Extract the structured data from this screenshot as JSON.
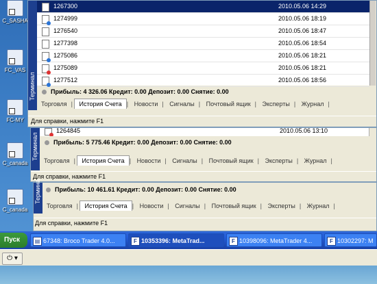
{
  "desktop_icons": [
    {
      "label": "C_SASHA"
    },
    {
      "label": "FC_VAS"
    },
    {
      "label": "FC-MY"
    },
    {
      "label": "C_canada"
    },
    {
      "label": "C_canada"
    }
  ],
  "window1": {
    "panel_label": "Терминал",
    "rows": [
      {
        "ticket": "1267300",
        "time": "2010.05.06 14:29",
        "selected": true,
        "icon": "doc"
      },
      {
        "ticket": "1274999",
        "time": "2010.05.06 18:19",
        "selected": false,
        "icon": "blue"
      },
      {
        "ticket": "1276540",
        "time": "2010.05.06 18:47",
        "selected": false,
        "icon": "doc"
      },
      {
        "ticket": "1277398",
        "time": "2010.05.06 18:54",
        "selected": false,
        "icon": "doc"
      },
      {
        "ticket": "1275086",
        "time": "2010.05.06 18:21",
        "selected": false,
        "icon": "blue"
      },
      {
        "ticket": "1275089",
        "time": "2010.05.06 18:21",
        "selected": false,
        "icon": "red"
      },
      {
        "ticket": "1277512",
        "time": "2010.05.06 18:56",
        "selected": false,
        "icon": "blue"
      }
    ],
    "status": "Прибыль: 4 326.06  Кредит: 0.00  Депозит: 0.00  Снятие: 0.00",
    "tabs": [
      "Торговля",
      "История Счета",
      "Новости",
      "Сигналы",
      "Почтовый ящик",
      "Эксперты",
      "Журнал"
    ],
    "active_tab": "История Счета",
    "help": "Для справки, нажмите F1"
  },
  "window2": {
    "panel_label": "Терминал",
    "rows": [
      {
        "ticket": "1264845",
        "time": "2010.05.06 13:10",
        "icon": "red"
      }
    ],
    "status": "Прибыль: 5 775.46  Кредит: 0.00  Депозит: 0.00  Снятие: 0.00",
    "tabs": [
      "Торговля",
      "История Счета",
      "Новости",
      "Сигналы",
      "Почтовый ящик",
      "Эксперты",
      "Журнал"
    ],
    "active_tab": "История Счета",
    "help": "Для справки, нажмите F1"
  },
  "window3": {
    "panel_label": "Термина",
    "status": "Прибыль: 10 461.61  Кредит: 0.00  Депозит: 0.00  Снятие: 0.00",
    "tabs": [
      "Торговля",
      "История Счета",
      "Новости",
      "Сигналы",
      "Почтовый ящик",
      "Эксперты",
      "Журнал"
    ],
    "active_tab": "История Счета",
    "help": "Для справки, нажмите F1"
  },
  "taskbar": {
    "start_label": "Пуск",
    "items": [
      {
        "label": "67348: Broco Trader 4.0...",
        "active": false,
        "icon": "chart-icon"
      },
      {
        "label": "10353396: MetaTrad...",
        "active": true,
        "icon": "F"
      },
      {
        "label": "10398096: MetaTrader 4...",
        "active": false,
        "icon": "F"
      },
      {
        "label": "10302297: M",
        "active": false,
        "icon": "F"
      }
    ]
  },
  "bottombar": {
    "power_label": "⏻ ▾"
  }
}
